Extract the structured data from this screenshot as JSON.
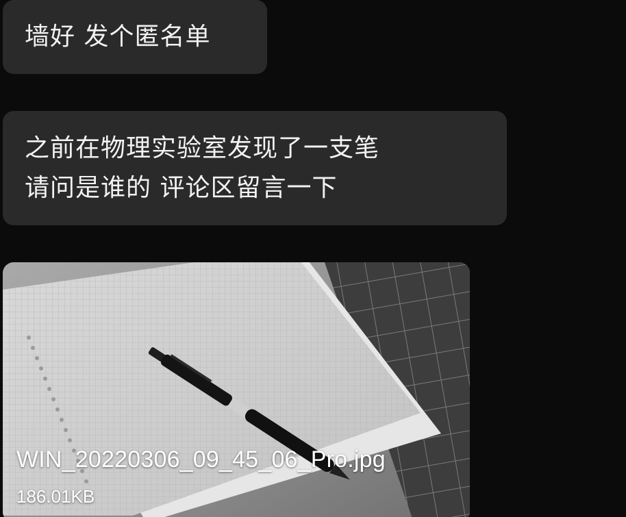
{
  "messages": [
    {
      "lines": [
        "墙好 发个匿名单"
      ]
    },
    {
      "lines": [
        "之前在物理实验室发现了一支笔",
        "请问是谁的 评论区留言一下"
      ]
    }
  ],
  "attachment": {
    "filename": "WIN_20220306_09_45_06_Pro.jpg",
    "size": "186.01KB"
  },
  "colors": {
    "background": "#0b0b0b",
    "bubble": "#2a2a2a",
    "text": "#f2f2f2"
  }
}
